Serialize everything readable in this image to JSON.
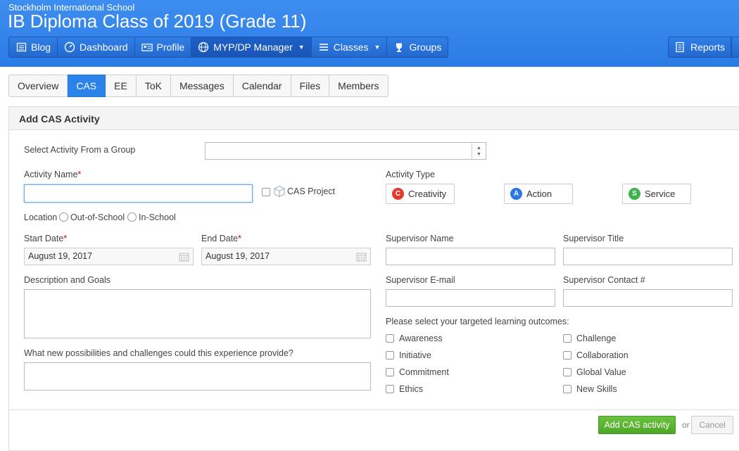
{
  "header": {
    "school": "Stockholm International School",
    "class_title": "IB Diploma Class of 2019 (Grade 11)",
    "nav": [
      {
        "label": "Blog",
        "icon": "blog-icon"
      },
      {
        "label": "Dashboard",
        "icon": "dashboard-icon"
      },
      {
        "label": "Profile",
        "icon": "profile-icon"
      },
      {
        "label": "MYP/DP Manager",
        "icon": "globe-icon",
        "active": true,
        "dropdown": true
      },
      {
        "label": "Classes",
        "icon": "classes-icon",
        "dropdown": true
      },
      {
        "label": "Groups",
        "icon": "trophy-icon"
      }
    ],
    "reports_label": "Reports"
  },
  "tabs": [
    {
      "label": "Overview"
    },
    {
      "label": "CAS",
      "active": true
    },
    {
      "label": "EE"
    },
    {
      "label": "ToK"
    },
    {
      "label": "Messages"
    },
    {
      "label": "Calendar"
    },
    {
      "label": "Files"
    },
    {
      "label": "Members"
    }
  ],
  "form": {
    "title": "Add CAS Activity",
    "select_group_label": "Select Activity From a Group",
    "select_group_value": "",
    "activity_name_label": "Activity Name",
    "activity_name_value": "",
    "cas_project_label": "CAS Project",
    "activity_type_label": "Activity Type",
    "activity_types": [
      {
        "letter": "C",
        "label": "Creativity",
        "color": "#e23b2e"
      },
      {
        "letter": "A",
        "label": "Action",
        "color": "#2b78e4"
      },
      {
        "letter": "S",
        "label": "Service",
        "color": "#3cb44b"
      }
    ],
    "location_label": "Location",
    "location_options": [
      "Out-of-School",
      "In-School"
    ],
    "start_date_label": "Start Date",
    "start_date_value": "August 19, 2017",
    "end_date_label": "End Date",
    "end_date_value": "August 19, 2017",
    "supervisor_name_label": "Supervisor Name",
    "supervisor_title_label": "Supervisor Title",
    "description_label": "Description and Goals",
    "supervisor_email_label": "Supervisor E-mail",
    "supervisor_contact_label": "Supervisor Contact #",
    "possibilities_label": "What new possibilities and challenges could this experience provide?",
    "outcomes_label": "Please select your targeted learning outcomes:",
    "outcomes_left": [
      "Awareness",
      "Initiative",
      "Commitment",
      "Ethics"
    ],
    "outcomes_right": [
      "Challenge",
      "Collaboration",
      "Global Value",
      "New Skills"
    ],
    "submit_label": "Add CAS activity",
    "or_label": "or",
    "cancel_label": "Cancel"
  },
  "colors": {
    "header_blue": "#2b7be6",
    "active_tab": "#2b83ea",
    "submit_green": "#5bb532"
  }
}
